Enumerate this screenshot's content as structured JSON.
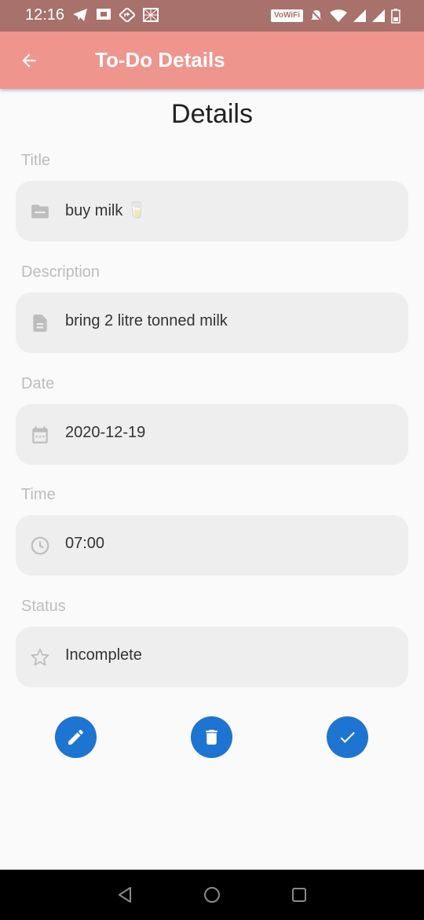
{
  "status_bar": {
    "time": "12:16",
    "network_badge": "VoWiFi",
    "icons": [
      "telegram-icon",
      "screen-cast-icon",
      "directions-icon",
      "grid-icon",
      "mute-icon",
      "wifi-icon",
      "signal-icon",
      "signal-icon",
      "battery-icon"
    ]
  },
  "appbar": {
    "title": "To-Do Details"
  },
  "page": {
    "heading": "Details"
  },
  "fields": [
    {
      "label": "Title",
      "value": "buy milk 🥛",
      "icon": "subject-icon"
    },
    {
      "label": "Description",
      "value": "bring 2 litre tonned milk",
      "icon": "document-icon"
    },
    {
      "label": "Date",
      "value": "2020-12-19",
      "icon": "calendar-icon"
    },
    {
      "label": "Time",
      "value": "07:00",
      "icon": "clock-icon"
    },
    {
      "label": "Status",
      "value": "Incomplete",
      "icon": "star-icon"
    }
  ],
  "actions": [
    "edit-icon",
    "delete-icon",
    "check-icon"
  ],
  "colors": {
    "status_bar": "#a8716c",
    "appbar": "#ee958d",
    "fab": "#1e74d1",
    "field_bg": "#eeeeee",
    "label": "#bdbdbd"
  }
}
